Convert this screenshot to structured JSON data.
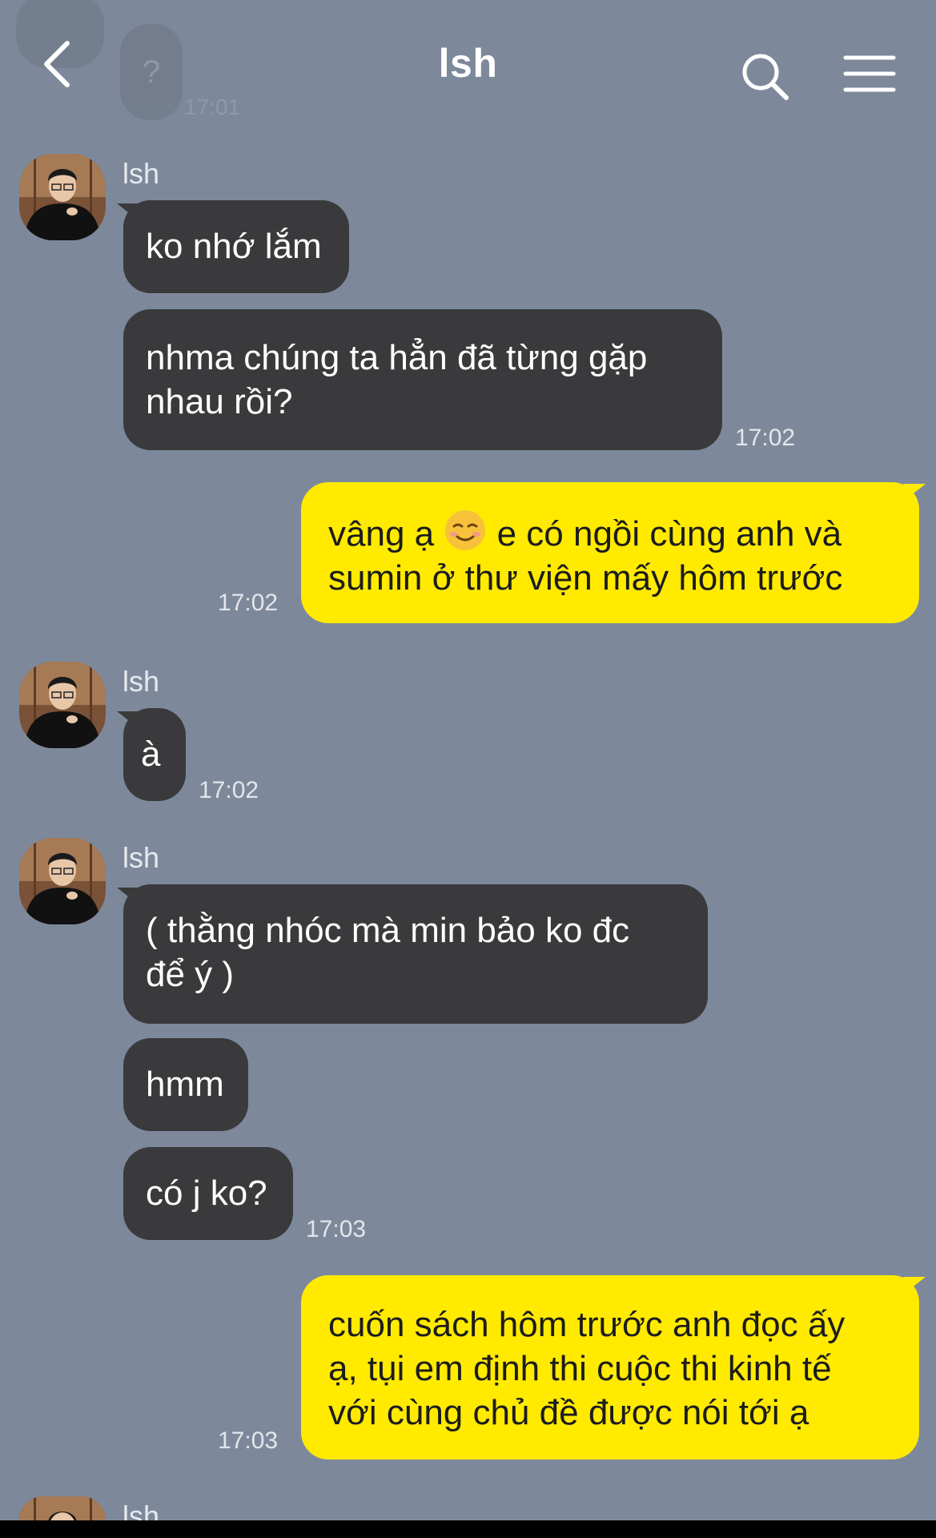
{
  "header": {
    "title": "lsh",
    "back_icon": "chevron-left-icon",
    "search_icon": "search-icon",
    "menu_icon": "hamburger-menu-icon"
  },
  "faded_top": {
    "text": "?",
    "time": "17:01"
  },
  "messages": [
    {
      "sender": "lsh",
      "bubbles": [
        "ko nhớ lắm",
        "nhma chúng ta hẳn đã từng gặp nhau rồi?"
      ],
      "time": "17:02"
    },
    {
      "sender": "me",
      "lines": [
        "vâng ạ",
        "e có ngồi cùng anh và",
        "sumin ở thư viện mấy hôm trước"
      ],
      "emoji": "smiling-face-icon",
      "time": "17:02"
    },
    {
      "sender": "lsh",
      "bubbles": [
        "à"
      ],
      "time": "17:02"
    },
    {
      "sender": "lsh",
      "bubbles": [
        "( thằng nhóc mà min bảo ko đc để ý )",
        "hmm",
        "có j ko?"
      ],
      "time": "17:03"
    },
    {
      "sender": "me",
      "lines": [
        "cuốn sách hôm trước anh đọc ấy",
        "ạ, tụi em định thi cuộc thi kinh tế",
        "với cùng chủ đề được nói tới ạ"
      ],
      "time": "17:03"
    },
    {
      "sender": "lsh",
      "bubbles": []
    }
  ],
  "colors": {
    "background": "#7d899b",
    "incoming_bubble": "#3a3a3c",
    "outgoing_bubble": "#ffea00"
  }
}
